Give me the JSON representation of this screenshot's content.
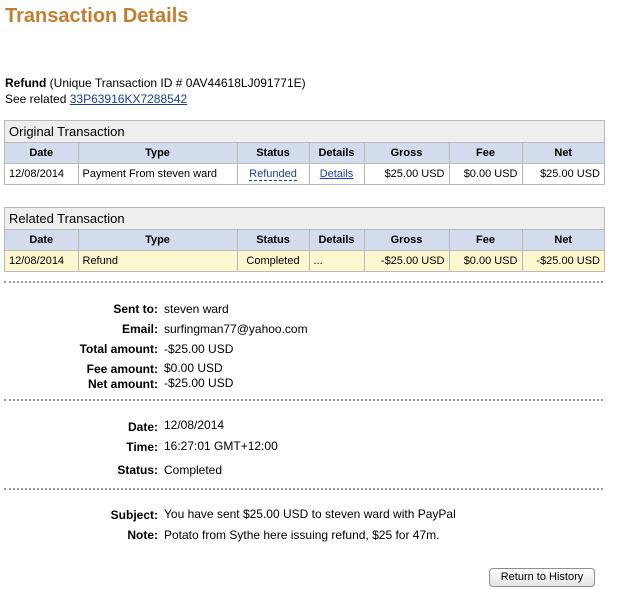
{
  "page_title": "Transaction Details",
  "refund_label": "Refund",
  "unique_id_text": "(Unique Transaction ID # 0AV44618LJ091771E)",
  "see_related_label": "See related",
  "related_id": "33P63916KX7288542",
  "original": {
    "heading": "Original Transaction",
    "columns": [
      "Date",
      "Type",
      "Status",
      "Details",
      "Gross",
      "Fee",
      "Net"
    ],
    "row": {
      "date": "12/08/2014",
      "type": "Payment From steven ward",
      "status": "Refunded",
      "details": "Details",
      "gross": "$25.00 USD",
      "fee": "$0.00 USD",
      "net": "$25.00 USD"
    }
  },
  "related": {
    "heading": "Related Transaction",
    "columns": [
      "Date",
      "Type",
      "Status",
      "Details",
      "Gross",
      "Fee",
      "Net"
    ],
    "row": {
      "date": "12/08/2014",
      "type": "Refund",
      "status": "Completed",
      "details": "...",
      "gross": "-$25.00 USD",
      "fee": "$0.00 USD",
      "net": "-$25.00 USD"
    }
  },
  "info1": {
    "sent_to_label": "Sent to:",
    "sent_to": "steven ward",
    "email_label": "Email:",
    "email": "surfingman77@yahoo.com",
    "total_label": "Total amount:",
    "total": "-$25.00 USD",
    "fee_label": "Fee amount:",
    "fee": "$0.00 USD",
    "net_label": "Net amount:",
    "net": "-$25.00 USD"
  },
  "info2": {
    "date_label": "Date:",
    "date": "12/08/2014",
    "time_label": "Time:",
    "time": "16:27:01 GMT+12:00",
    "status_label": "Status:",
    "status": "Completed"
  },
  "info3": {
    "subject_label": "Subject:",
    "subject": "You have sent $25.00 USD to steven ward with PayPal",
    "note_label": "Note:",
    "note": "Potato from Sythe here issuing refund, $25 for 47m."
  },
  "return_button": "Return to History",
  "colors": {
    "title": "#c47e2f",
    "header_row": "#d2dcec",
    "highlight_row": "#fbf8cf",
    "link": "#1d3f9c"
  }
}
